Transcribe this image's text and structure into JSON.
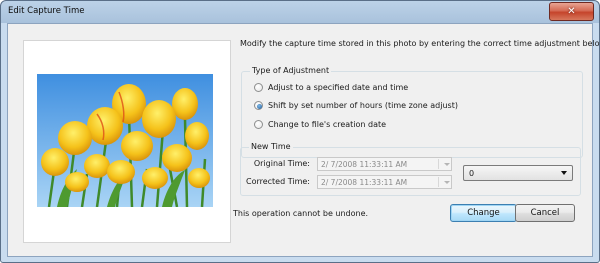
{
  "window": {
    "title": "Edit Capture Time",
    "close_glyph": "✕",
    "colors": {
      "frame": "#bcd2e8",
      "client": "#f0f0f0",
      "close_button": "#c5442b",
      "default_button_border": "#3c7fb1"
    }
  },
  "photo": {
    "description_icon": "tulips-photo"
  },
  "intro_text": "Modify the capture time stored in this photo by entering the correct time adjustment below.",
  "adjustment_type": {
    "legend": "Type of Adjustment",
    "options": [
      {
        "label": "Adjust to a specified date and time",
        "checked": false
      },
      {
        "label": "Shift by set number of hours (time zone adjust)",
        "checked": true
      },
      {
        "label": "Change to file's creation date",
        "checked": false
      }
    ]
  },
  "new_time": {
    "legend": "New Time",
    "original_label": "Original Time:",
    "original_value": "2/  7/2008 11:33:11 AM",
    "corrected_label": "Corrected Time:",
    "corrected_value": "2/  7/2008 11:33:11 AM",
    "hours_shift": "0"
  },
  "footer": {
    "note": "This operation cannot be undone.",
    "change_label": "Change",
    "cancel_label": "Cancel"
  }
}
